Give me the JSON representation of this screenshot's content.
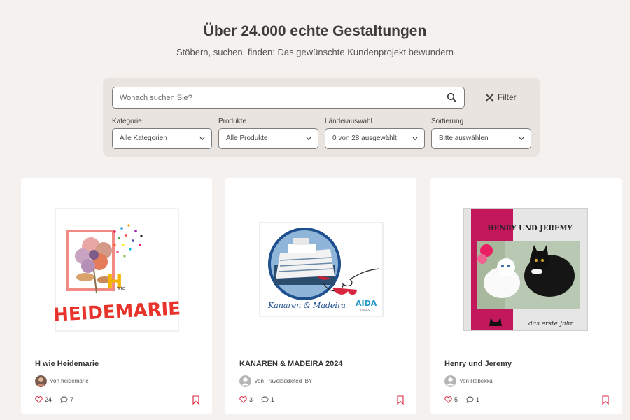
{
  "header": {
    "title": "Über 24.000 echte Gestaltungen",
    "subtitle": "Stöbern, suchen, finden: Das gewünschte Kundenprojekt bewundern"
  },
  "search": {
    "placeholder": "Wonach suchen Sie?",
    "filter_label": "Filter"
  },
  "filters": [
    {
      "label": "Kategorie",
      "value": "Alle Kategorien"
    },
    {
      "label": "Produkte",
      "value": "Alle Produkte"
    },
    {
      "label": "Länderauswahl",
      "value": "0 von 28 ausgewählt"
    },
    {
      "label": "Sortierung",
      "value": "Bitte auswählen"
    }
  ],
  "cards": [
    {
      "title": "H wie Heidemarie",
      "author": "von heidemarie",
      "likes": "24",
      "comments": "7",
      "cover_text": "HEIDEMARIE",
      "cover_small": "wie"
    },
    {
      "title": "KANAREN & MADEIRA 2024",
      "author": "von Traveladdicted_BY",
      "likes": "3",
      "comments": "1",
      "cover_text": "Kanaren & Madeira",
      "cover_logo": "AIDA",
      "cover_logo_sub": "CRUISES"
    },
    {
      "title": "Henry und Jeremy",
      "author": "von Rebekka",
      "likes": "5",
      "comments": "1",
      "cover_text": "HENRY UND JEREMY",
      "cover_sub": "das erste Jahr"
    }
  ],
  "colors": {
    "background": "#f4f1ee",
    "panel": "#e9e4df",
    "accent_red": "#d7263d",
    "pink": "#c2185b"
  },
  "icons": [
    "search-icon",
    "close-icon",
    "chevron-down-icon",
    "heart-icon",
    "comment-icon",
    "bookmark-icon",
    "avatar"
  ]
}
